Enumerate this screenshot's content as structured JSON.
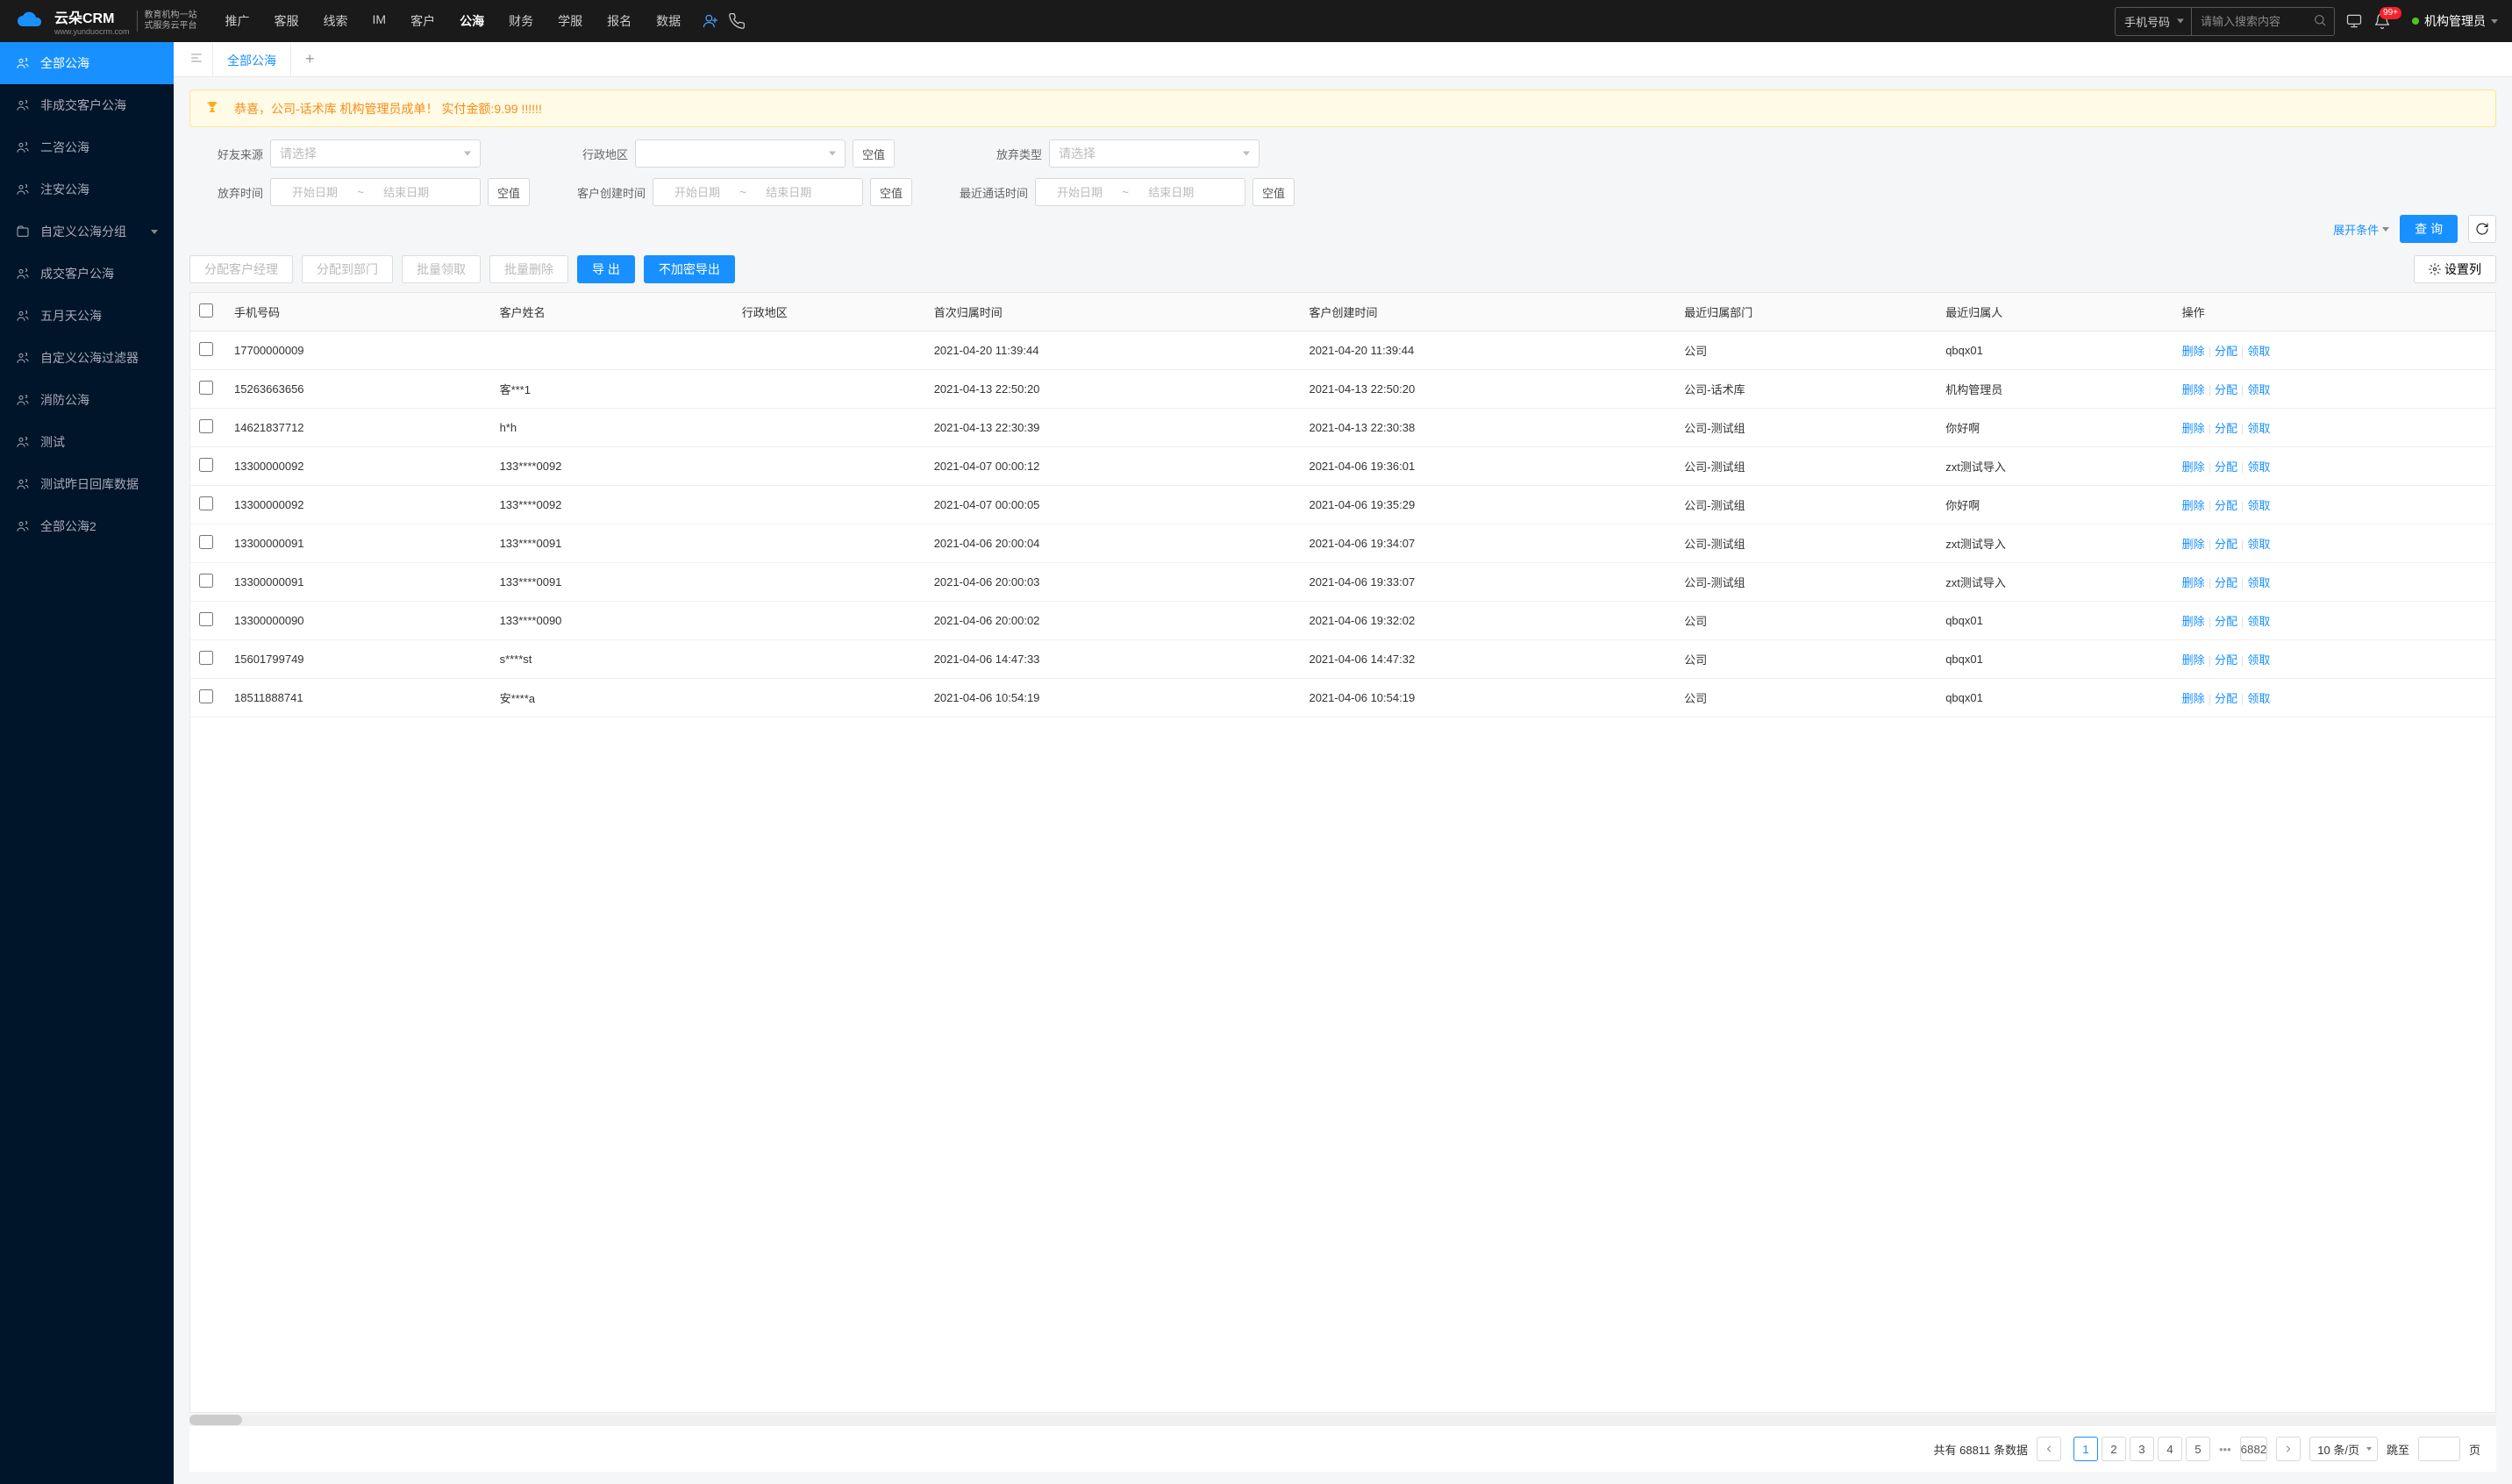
{
  "header": {
    "logo_text": "云朵CRM",
    "logo_sub1": "教育机构一站",
    "logo_sub2": "式服务云平台",
    "logo_url": "www.yunduocrm.com",
    "nav": [
      "推广",
      "客服",
      "线索",
      "IM",
      "客户",
      "公海",
      "财务",
      "学服",
      "报名",
      "数据"
    ],
    "nav_active": 5,
    "search_type": "手机号码",
    "search_placeholder": "请输入搜索内容",
    "badge": "99+",
    "user_name": "机构管理员"
  },
  "sidebar": {
    "items": [
      {
        "label": "全部公海",
        "icon": "users"
      },
      {
        "label": "非成交客户公海",
        "icon": "users"
      },
      {
        "label": "二咨公海",
        "icon": "users"
      },
      {
        "label": "注安公海",
        "icon": "users"
      },
      {
        "label": "自定义公海分组",
        "icon": "folder",
        "chev": true
      },
      {
        "label": "成交客户公海",
        "icon": "users"
      },
      {
        "label": "五月天公海",
        "icon": "users"
      },
      {
        "label": "自定义公海过滤器",
        "icon": "users"
      },
      {
        "label": "消防公海",
        "icon": "users"
      },
      {
        "label": "测试",
        "icon": "users"
      },
      {
        "label": "测试昨日回库数据",
        "icon": "users"
      },
      {
        "label": "全部公海2",
        "icon": "users"
      }
    ],
    "active": 0
  },
  "tabs": {
    "active": "全部公海"
  },
  "banner": {
    "text": "恭喜，公司-话术库  机构管理员成单！  实付金额:9.99 !!!!!!"
  },
  "filters": {
    "source_label": "好友来源",
    "region_label": "行政地区",
    "abandon_type_label": "放弃类型",
    "abandon_time_label": "放弃时间",
    "create_time_label": "客户创建时间",
    "last_call_label": "最近通话时间",
    "placeholder_select": "请选择",
    "placeholder_start": "开始日期",
    "placeholder_end": "结束日期",
    "empty_btn": "空值",
    "expand_label": "展开条件",
    "search_btn": "查 询"
  },
  "actions": {
    "assign_mgr": "分配客户经理",
    "assign_dept": "分配到部门",
    "batch_claim": "批量领取",
    "batch_delete": "批量删除",
    "export": "导 出",
    "export_plain": "不加密导出",
    "set_columns": "设置列"
  },
  "table": {
    "headers": [
      "手机号码",
      "客户姓名",
      "行政地区",
      "首次归属时间",
      "客户创建时间",
      "最近归属部门",
      "最近归属人",
      "操作"
    ],
    "op_delete": "删除",
    "op_assign": "分配",
    "op_claim": "领取",
    "rows": [
      {
        "phone": "17700000009",
        "name": "",
        "region": "",
        "first": "2021-04-20 11:39:44",
        "created": "2021-04-20 11:39:44",
        "dept": "公司",
        "owner": "qbqx01"
      },
      {
        "phone": "15263663656",
        "name": "客***1",
        "region": "",
        "first": "2021-04-13 22:50:20",
        "created": "2021-04-13 22:50:20",
        "dept": "公司-话术库",
        "owner": "机构管理员"
      },
      {
        "phone": "14621837712",
        "name": "h*h",
        "region": "",
        "first": "2021-04-13 22:30:39",
        "created": "2021-04-13 22:30:38",
        "dept": "公司-测试组",
        "owner": "你好啊"
      },
      {
        "phone": "13300000092",
        "name": "133****0092",
        "region": "",
        "first": "2021-04-07 00:00:12",
        "created": "2021-04-06 19:36:01",
        "dept": "公司-测试组",
        "owner": "zxt测试导入"
      },
      {
        "phone": "13300000092",
        "name": "133****0092",
        "region": "",
        "first": "2021-04-07 00:00:05",
        "created": "2021-04-06 19:35:29",
        "dept": "公司-测试组",
        "owner": "你好啊"
      },
      {
        "phone": "13300000091",
        "name": "133****0091",
        "region": "",
        "first": "2021-04-06 20:00:04",
        "created": "2021-04-06 19:34:07",
        "dept": "公司-测试组",
        "owner": "zxt测试导入"
      },
      {
        "phone": "13300000091",
        "name": "133****0091",
        "region": "",
        "first": "2021-04-06 20:00:03",
        "created": "2021-04-06 19:33:07",
        "dept": "公司-测试组",
        "owner": "zxt测试导入"
      },
      {
        "phone": "13300000090",
        "name": "133****0090",
        "region": "",
        "first": "2021-04-06 20:00:02",
        "created": "2021-04-06 19:32:02",
        "dept": "公司",
        "owner": "qbqx01"
      },
      {
        "phone": "15601799749",
        "name": "s****st",
        "region": "",
        "first": "2021-04-06 14:47:33",
        "created": "2021-04-06 14:47:32",
        "dept": "公司",
        "owner": "qbqx01"
      },
      {
        "phone": "18511888741",
        "name": "安****a",
        "region": "",
        "first": "2021-04-06 10:54:19",
        "created": "2021-04-06 10:54:19",
        "dept": "公司",
        "owner": "qbqx01"
      }
    ]
  },
  "pager": {
    "total_prefix": "共有 ",
    "total": "68811",
    "total_suffix": " 条数据",
    "pages": [
      "1",
      "2",
      "3",
      "4",
      "5"
    ],
    "last": "6882",
    "page_size": "10 条/页",
    "jump_label": "跳至",
    "jump_suffix": "页"
  }
}
